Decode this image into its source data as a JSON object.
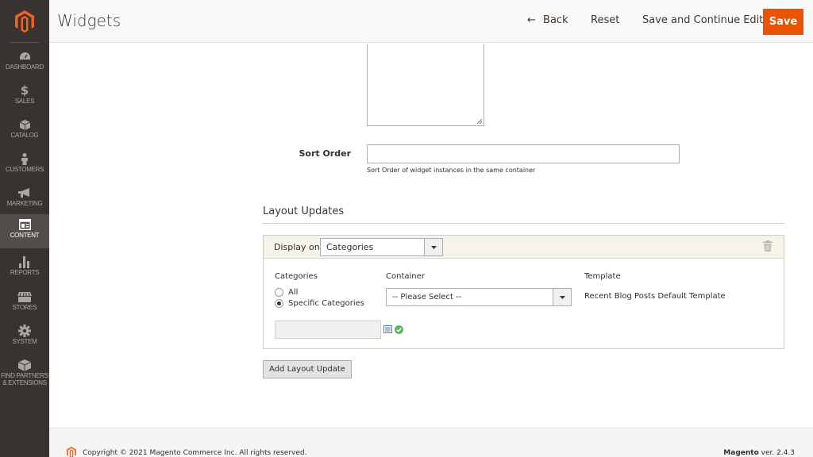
{
  "sidebar": {
    "logo_name": "magento-logo",
    "items": [
      {
        "label": "DASHBOARD",
        "icon": "gauge-icon"
      },
      {
        "label": "SALES",
        "icon": "dollar-icon"
      },
      {
        "label": "CATALOG",
        "icon": "box-icon"
      },
      {
        "label": "CUSTOMERS",
        "icon": "person-icon"
      },
      {
        "label": "MARKETING",
        "icon": "megaphone-icon"
      },
      {
        "label": "CONTENT",
        "icon": "layout-icon"
      },
      {
        "label": "REPORTS",
        "icon": "bar-chart-icon"
      },
      {
        "label": "STORES",
        "icon": "storefront-icon"
      },
      {
        "label": "SYSTEM",
        "icon": "gear-icon"
      },
      {
        "label": "FIND PARTNERS\n& EXTENSIONS",
        "icon": "cube-icon"
      }
    ],
    "active_index": 5
  },
  "header": {
    "title": "Widgets",
    "back_label": "Back",
    "reset_label": "Reset",
    "save_continue_label": "Save and Continue Edit",
    "save_label": "Save",
    "accent": "#eb5202"
  },
  "form": {
    "sort_order_label": "Sort Order",
    "sort_order_value": "",
    "sort_order_note": "Sort Order of widget instances in the same container"
  },
  "layout_updates": {
    "title": "Layout Updates",
    "display_on_label": "Display on",
    "display_on_value": "Categories",
    "categories_label": "Categories",
    "radio_all": "All",
    "radio_specific": "Specific Categories",
    "container_label": "Container",
    "container_value": "-- Please Select --",
    "template_label": "Template",
    "template_value": "Recent Blog Posts Default Template",
    "add_button": "Add Layout Update"
  },
  "footer": {
    "copyright": "Copyright © 2021 Magento Commerce Inc. All rights reserved.",
    "brand": "Magento",
    "version": " ver. 2.4.3"
  }
}
